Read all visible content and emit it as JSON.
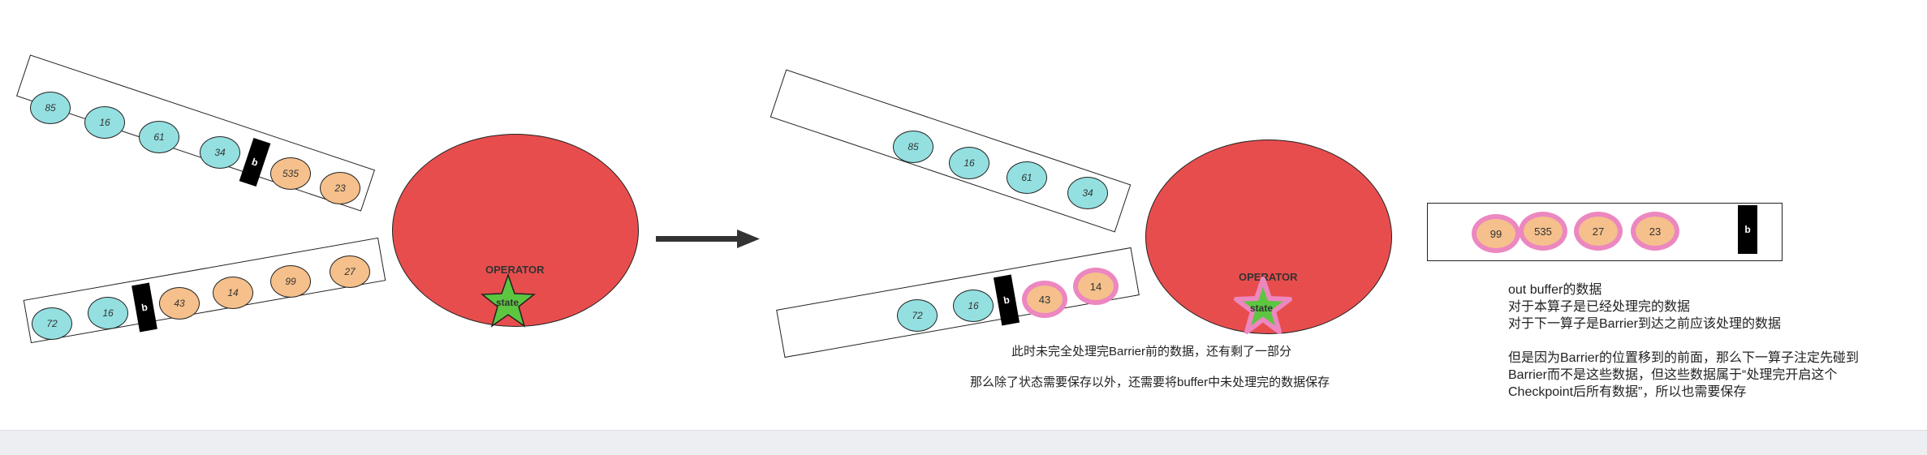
{
  "operator_label": "OPERATOR",
  "state_label": "state",
  "barrier_label": "b",
  "stage1": {
    "upper_lane": [
      "85",
      "16",
      "61",
      "34",
      "535",
      "23"
    ],
    "lower_lane": [
      "72",
      "16",
      "43",
      "14",
      "99",
      "27"
    ]
  },
  "stage2": {
    "upper_lane": [
      "85",
      "16",
      "61",
      "34"
    ],
    "lower_lane": [
      "72",
      "16",
      "43",
      "14"
    ],
    "note_remaining": "此时未完全处理完Barrier前的数据，还有剩了一部分",
    "note_save": "那么除了状态需要保存以外，还需要将buffer中未处理完的数据保存"
  },
  "out_buffer": {
    "items": [
      "99",
      "535",
      "27",
      "23"
    ],
    "lines": [
      "out buffer的数据",
      "对于本算子是已经处理完的数据",
      "对于下一算子是Barrier到达之前应该处理的数据",
      "",
      "但是因为Barrier的位置移到的前面，那么下一算子注定先碰到",
      "Barrier而不是这些数据，但这些数据属于“处理完开启这个",
      "Checkpoint后所有数据”，所以也需要保存"
    ]
  },
  "colors": {
    "operator": "#e84d4d",
    "blue_record": "#94e0e1",
    "orange_record": "#f5c08b",
    "highlight_ring": "#ec87c0",
    "state_star": "#5cc640",
    "barrier": "#000000"
  }
}
